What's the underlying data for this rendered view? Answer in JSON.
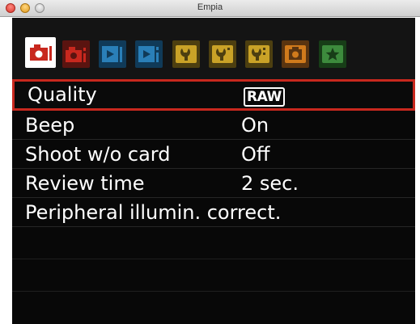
{
  "window": {
    "title": "Empia"
  },
  "tabs": [
    {
      "icon": "camera-shoot-1-icon",
      "color": "#c8281e",
      "active": true
    },
    {
      "icon": "camera-shoot-2-icon",
      "color": "#c8281e",
      "active": false
    },
    {
      "icon": "playback-1-icon",
      "color": "#2a7fb8",
      "active": false
    },
    {
      "icon": "playback-2-icon",
      "color": "#2a7fb8",
      "active": false
    },
    {
      "icon": "setup-1-icon",
      "color": "#c9a227",
      "active": false
    },
    {
      "icon": "setup-2-icon",
      "color": "#c9a227",
      "active": false
    },
    {
      "icon": "setup-3-icon",
      "color": "#c9a227",
      "active": false
    },
    {
      "icon": "custom-functions-icon",
      "color": "#d07a1c",
      "active": false
    },
    {
      "icon": "my-menu-star-icon",
      "color": "#3d8b3d",
      "active": false
    }
  ],
  "menu": {
    "items": [
      {
        "label": "Quality",
        "value": "RAW"
      },
      {
        "label": "Beep",
        "value": "On"
      },
      {
        "label": "Shoot w/o card",
        "value": "Off"
      },
      {
        "label": "Review time",
        "value": "2 sec."
      },
      {
        "label": "Peripheral illumin. correct.",
        "value": ""
      }
    ]
  }
}
